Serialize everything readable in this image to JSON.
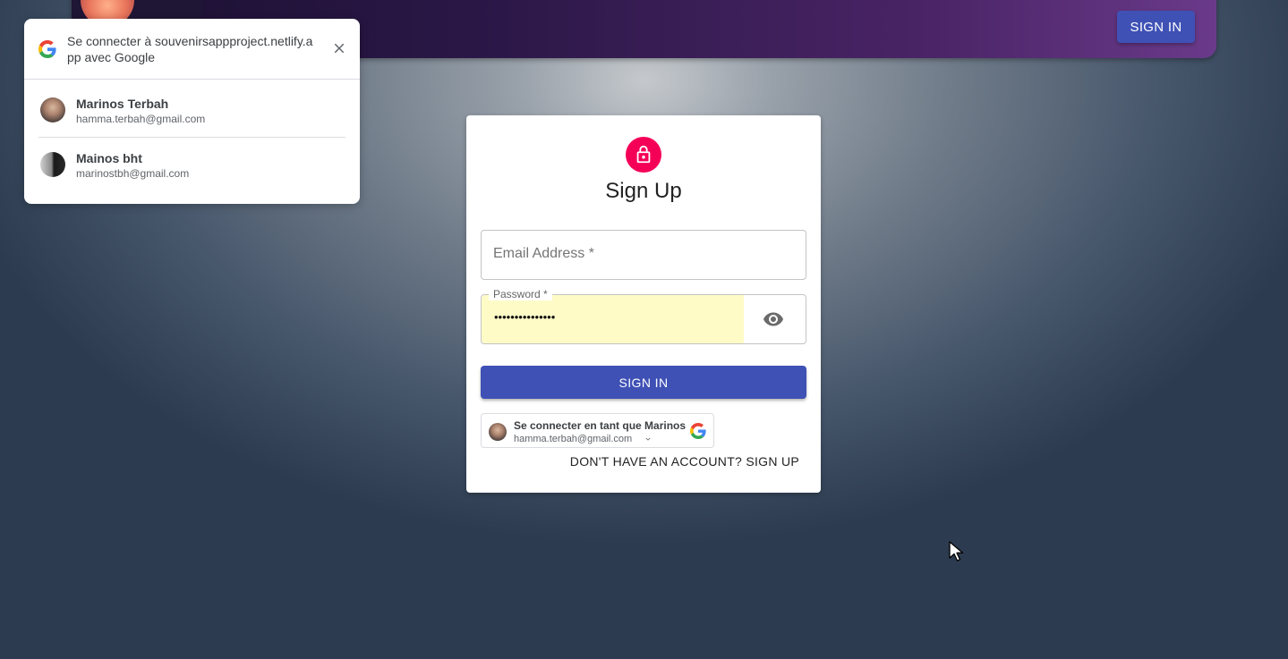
{
  "header": {
    "signin_label": "SIGN IN"
  },
  "google_popup": {
    "title": "Se connecter à souvenirsappproject.netlify.app avec Google",
    "accounts": [
      {
        "name": "Marinos Terbah",
        "email": "hamma.terbah@gmail.com"
      },
      {
        "name": "Mainos bht",
        "email": "marinostbh@gmail.com"
      }
    ]
  },
  "form": {
    "title": "Sign Up",
    "email_label": "Email Address *",
    "email_value": "",
    "password_label": "Password *",
    "password_value": "•••••••••••••••",
    "submit_label": "SIGN IN",
    "google_button": {
      "title": "Se connecter en tant que Marinos",
      "email": "hamma.terbah@gmail.com"
    },
    "switch_link": "DON'T HAVE AN ACCOUNT? SIGN UP"
  },
  "colors": {
    "primary": "#3f51b5",
    "secondary": "#f50057",
    "autofill": "#fffbc7"
  },
  "icons": {
    "lock": "lock-outlined-icon",
    "eye": "visibility-icon",
    "google": "google-g-icon",
    "close": "close-icon",
    "chevron": "chevron-down-icon"
  }
}
